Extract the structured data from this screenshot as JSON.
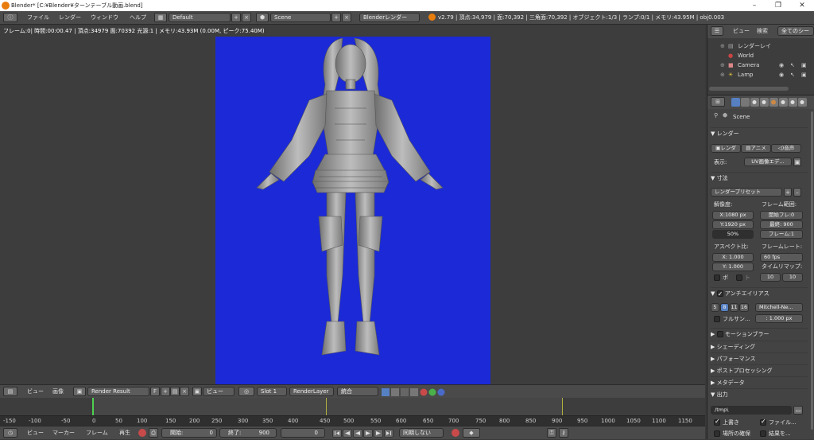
{
  "window": {
    "title": "Blender* [C:¥Blender¥ターンテーブル動画.blend]",
    "minimize": "–",
    "maximize": "❐",
    "close": "✕"
  },
  "info_header": {
    "menus": [
      "ファイル",
      "レンダー",
      "ウィンドウ",
      "ヘルプ"
    ],
    "layout": "Default",
    "scene": "Scene",
    "engine": "Blenderレンダー",
    "stats": "v2.79 | 頂点:34,979 | 面:70,392 | 三角面:70,392 | オブジェクト:1/3 | ランプ:0/1 | メモリ:43.95M | obj0.003"
  },
  "render": {
    "overlay": "フレーム:0| 時間:00:00.47 | 頂点:34979 面:70392 光源:1 | メモリ:43.93M (0.00M, ピーク:75.40M)"
  },
  "image_header": {
    "view_menu": "ビュー",
    "image_menu": "画像",
    "image_name": "Render Result",
    "fake_user": "F",
    "display_mode": "ビュー",
    "slot": "Slot 1",
    "layer": "RenderLayer",
    "pass": "統合"
  },
  "timeline": {
    "ticks": [
      "-150",
      "-100",
      "-50",
      "0",
      "50",
      "100",
      "150",
      "200",
      "250",
      "300",
      "350",
      "400",
      "450",
      "500",
      "550",
      "600",
      "650",
      "700",
      "750",
      "800",
      "850",
      "900",
      "950",
      "1000",
      "1050",
      "1100",
      "1150"
    ],
    "menus": [
      "ビュー",
      "マーカー",
      "フレーム",
      "再生"
    ],
    "start_label": "開始:",
    "start_value": "0",
    "end_label": "終了:",
    "end_value": "900",
    "current_frame": "0",
    "sync": "同期しない"
  },
  "outliner": {
    "view": "ビュー",
    "search": "検索",
    "filter": "全てのシー",
    "items": [
      "レンダーレイ",
      "World",
      "Camera",
      "Lamp"
    ]
  },
  "properties": {
    "scene_name": "Scene",
    "render_section": "レンダー",
    "render_btn": "レンダ",
    "anim_btn": "アニメ",
    "audio_btn": "音声",
    "display_label": "表示:",
    "display_value": "UV画像エデ...",
    "dimensions_section": "寸法",
    "preset": "レンダープリセット",
    "resolution_label": "解像度:",
    "frame_range_label": "フレーム範囲:",
    "res_x": "X:1080 px",
    "res_y": "Y:1920 px",
    "res_pct": "50%",
    "frame_start": "開始フレ:0",
    "frame_end": "最終: 900",
    "frame_step": "フレーム:1",
    "aspect_label": "アスペクト比:",
    "framerate_label": "フレームレート:",
    "aspect_x": "X: 1.000",
    "aspect_y": "Y: 1.000",
    "fps": "60 fps",
    "time_remap": "タイムリマップ:",
    "border": "ボ",
    "crop": "ト",
    "remap_old": "10",
    "remap_new": "10",
    "aa_section": "アンチエイリアス",
    "aa_samples": [
      "5",
      "8",
      "11",
      "16"
    ],
    "aa_filter": "Mitchell-Ne...",
    "full_sample": "フルサン...",
    "filter_size": ": 1.000 px",
    "collapsed": [
      "モーションブラー",
      "シェーディング",
      "パフォーマンス",
      "ポストプロセッシング",
      "メタデータ"
    ],
    "output_section": "出力",
    "output_path": "/tmp\\",
    "overwrite": "上書き",
    "file_ext": "ファイル...",
    "placeholders": "場所の確保",
    "cache": "結果を...",
    "colors": {
      "accent": "#5680c2",
      "render_bg": "#1b2ad6"
    }
  }
}
